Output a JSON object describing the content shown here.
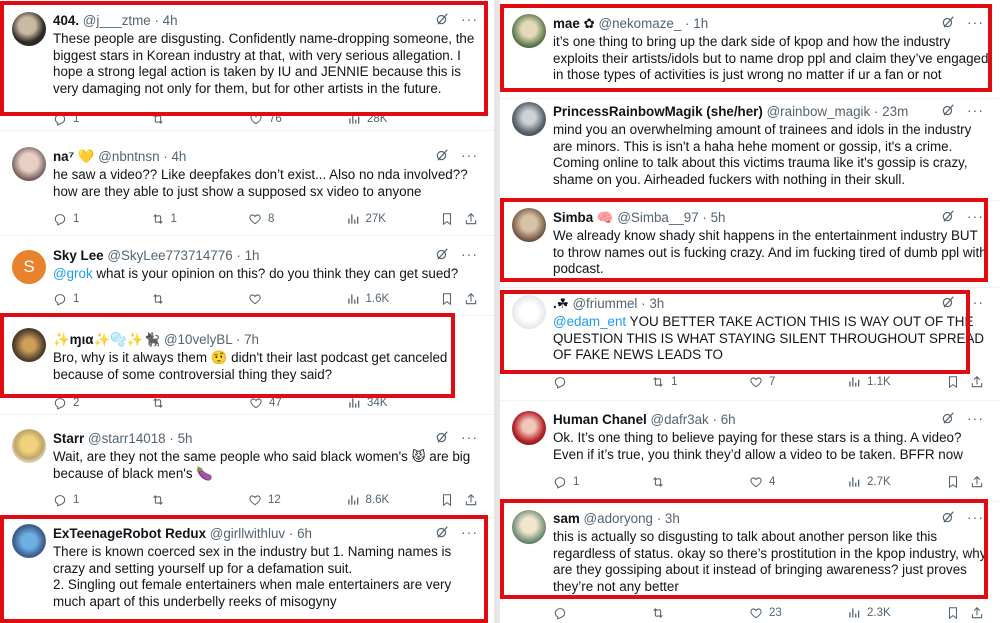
{
  "colors": {
    "accent": "#1d9bf0",
    "highlight": "#e10b12",
    "muted": "#536471"
  },
  "left": [
    {
      "name": "404.",
      "handle": "@j___ztme",
      "time": "4h",
      "text": "These people are disgusting. Confidently name-dropping someone, the biggest stars in Korean industry at that, with very serious allegation. I hope a strong legal action is taken by IU and JENNIE because this is very damaging not only for them, but for other artists in the future.",
      "mention": "",
      "replies": "1",
      "retweets": "",
      "likes": "76",
      "views": "28K"
    },
    {
      "name": "na⁷ 💛",
      "handle": "@nbntnsn",
      "time": "4h",
      "text": "he saw a video?? Like deepfakes don’t exist... Also no nda involved?? how are they able to just show a supposed sx video to anyone",
      "mention": "",
      "replies": "1",
      "retweets": "1",
      "likes": "8",
      "views": "27K"
    },
    {
      "name": "Sky Lee",
      "handle": "@SkyLee773714776",
      "time": "1h",
      "text": " what is your opinion on this? do you think they can get sued?",
      "mention": "@grok",
      "replies": "1",
      "retweets": "",
      "likes": "",
      "views": "1.6K"
    },
    {
      "name": "✨ɱια✨🫧✨🐈‍⬛",
      "handle": "@10velyBL",
      "time": "7h",
      "text": "Bro, why is it always them 🤨 didn't their last podcast get canceled because of some controversial thing they said?",
      "mention": "",
      "replies": "2",
      "retweets": "",
      "likes": "47",
      "views": "34K"
    },
    {
      "name": "Starr",
      "handle": "@starr14018",
      "time": "5h",
      "text": "Wait, are they not the same people who said black women's 😾 are big because of black men's 🍆",
      "mention": "",
      "replies": "1",
      "retweets": "",
      "likes": "12",
      "views": "8.6K"
    },
    {
      "name": "ExTeenageRobot Redux",
      "handle": "@girllwithluv",
      "time": "6h",
      "text": "There is known coerced sex in the industry but 1. Naming names is crazy and setting yourself up for a defamation suit.\n2. Singling out female entertainers when male entertainers are very much apart of this underbelly reeks of misogyny",
      "mention": "",
      "replies": "",
      "retweets": "",
      "likes": "",
      "views": ""
    }
  ],
  "right": [
    {
      "name": "mae ✿",
      "handle": "@nekomaze_",
      "time": "1h",
      "text": "it’s one thing to bring up the dark side of kpop and how the industry exploits their artists/idols but to name drop ppl and claim they’ve engaged in those types of activities is just wrong no matter if ur a fan or not",
      "mention": "",
      "replies": "",
      "retweets": "",
      "likes": "",
      "views": ""
    },
    {
      "name": "PrincessRainbowMagik (she/her)",
      "handle": "@rainbow_magik",
      "time": "23m",
      "text": "mind you an overwhelming amount of trainees and idols in the industry are minors. This is isn't a haha hehe moment or gossip, it's a crime. Coming online to talk about this victims trauma like it's gossip is crazy, shame on you. Airheaded fuckers with nothing in their skull.",
      "mention": "",
      "replies": "",
      "retweets": "",
      "likes": "",
      "views": ""
    },
    {
      "name": "Simba 🧠",
      "handle": "@Simba__97",
      "time": "5h",
      "text": "We already know shady shit happens in the entertainment industry BUT to throw names out is fucking crazy. And im fucking tired of dumb ppl with podcast.",
      "mention": "",
      "replies": "",
      "retweets": "",
      "likes": "",
      "views": ""
    },
    {
      "name": ".☘",
      "handle": "@friummel",
      "time": "3h",
      "text": " YOU BETTER TAKE ACTION THIS IS WAY OUT OF THE QUESTION THIS IS WHAT STAYING SILENT THROUGHOUT SPREAD OF FAKE NEWS LEADS TO",
      "mention": "@edam_ent",
      "replies": "",
      "retweets": "1",
      "likes": "7",
      "views": "1.1K"
    },
    {
      "name": "Human Chanel",
      "handle": "@dafr3ak",
      "time": "6h",
      "text": "Ok. It’s one thing to believe paying for these stars is a thing. A video? Even if it’s true, you think they’d allow a video to be taken. BFFR now",
      "mention": "",
      "replies": "1",
      "retweets": "",
      "likes": "4",
      "views": "2.7K"
    },
    {
      "name": "sam",
      "handle": "@adoryong",
      "time": "3h",
      "text": "this is actually so disgusting to talk about another person like this regardless of status. okay so there’s prostitution in the kpop industry, why are they gossiping about it instead of bringing awareness? just proves they’re not any better",
      "mention": "",
      "replies": "",
      "retweets": "",
      "likes": "23",
      "views": "2.3K"
    }
  ]
}
